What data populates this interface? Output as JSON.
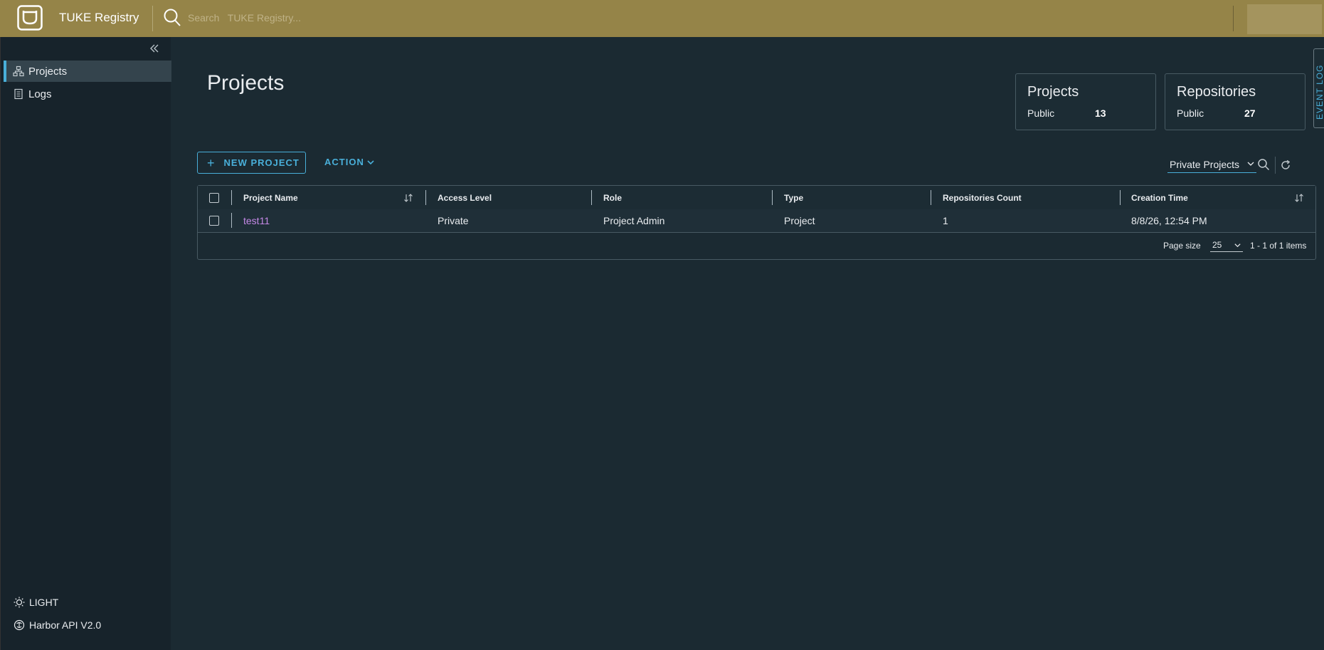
{
  "app": {
    "title": "TUKE Registry",
    "search_placeholder": "Search   TUKE Registry..."
  },
  "sidebar": {
    "items": [
      {
        "label": "Projects",
        "icon": "projects-icon",
        "active": true
      },
      {
        "label": "Logs",
        "icon": "logs-icon",
        "active": false
      }
    ],
    "theme_toggle": "LIGHT",
    "api_link": "Harbor API V2.0"
  },
  "main": {
    "title": "Projects",
    "stats": [
      {
        "title": "Projects",
        "label": "Public",
        "value": "13"
      },
      {
        "title": "Repositories",
        "label": "Public",
        "value": "27"
      }
    ],
    "event_log_tab": "EVENT LOG",
    "toolbar": {
      "new_project": "NEW PROJECT",
      "action": "ACTION",
      "filter_selected": "Private Projects"
    },
    "table": {
      "columns": [
        "Project Name",
        "Access Level",
        "Role",
        "Type",
        "Repositories Count",
        "Creation Time"
      ],
      "rows": [
        {
          "name": "test11",
          "access": "Private",
          "role": "Project Admin",
          "type": "Project",
          "repo_count": "1",
          "created": "8/8/26, 12:54 PM"
        }
      ],
      "footer": {
        "page_size_label": "Page size",
        "page_size": "25",
        "info": "1 - 1 of 1 items"
      }
    }
  },
  "colors": {
    "header": "#958448",
    "accent": "#49afd9",
    "link": "#c488e6",
    "background": "#1b2a32",
    "sidebar": "#17232b"
  }
}
